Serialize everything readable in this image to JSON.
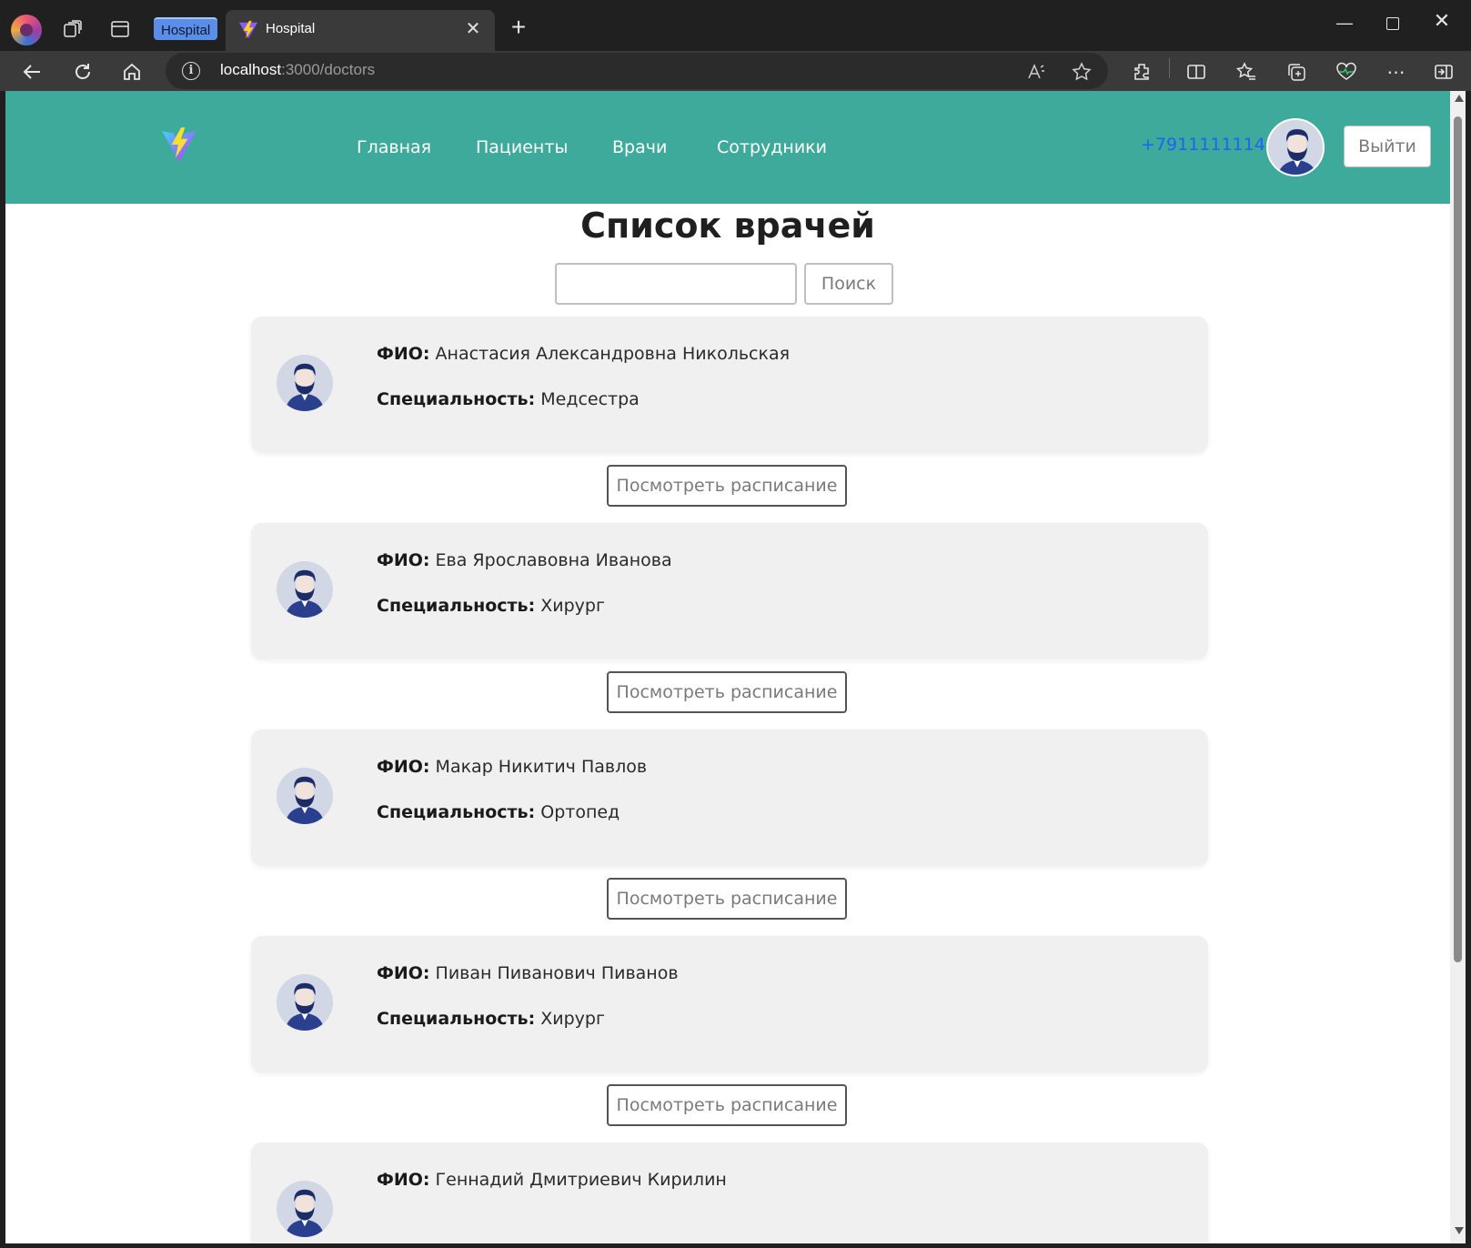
{
  "browser": {
    "tab_group_label": "Hospital",
    "tab_title": "Hospital",
    "url_host": "localhost",
    "url_path": ":3000/doctors"
  },
  "header": {
    "nav": [
      "Главная",
      "Пациенты",
      "Врачи",
      "Сотрудники"
    ],
    "phone": "+7911111114",
    "logout_label": "Выйти"
  },
  "page": {
    "title": "Список врачей",
    "search_value": "",
    "search_button": "Поиск",
    "name_label": "ФИО:",
    "specialty_label": "Специальность:",
    "schedule_button": "Посмотреть расписание"
  },
  "doctors": [
    {
      "name": "Анастасия Александровна Никольская",
      "specialty": "Медсестра"
    },
    {
      "name": "Ева Ярославовна Иванова",
      "specialty": "Хирург"
    },
    {
      "name": "Макар Никитич Павлов",
      "specialty": "Ортопед"
    },
    {
      "name": "Пиван Пиванович Пиванов",
      "specialty": "Хирург"
    },
    {
      "name": "Геннадий Дмитриевич Кирилин",
      "specialty": ""
    }
  ],
  "colors": {
    "header_bg": "#3daa9b",
    "phone_link": "#1e64f0",
    "card_bg": "#f0f0f0",
    "avatar_shirt": "#2b3f8f"
  },
  "icons": {
    "logo": "vite-logo",
    "avatar": "bearded-man-avatar"
  }
}
